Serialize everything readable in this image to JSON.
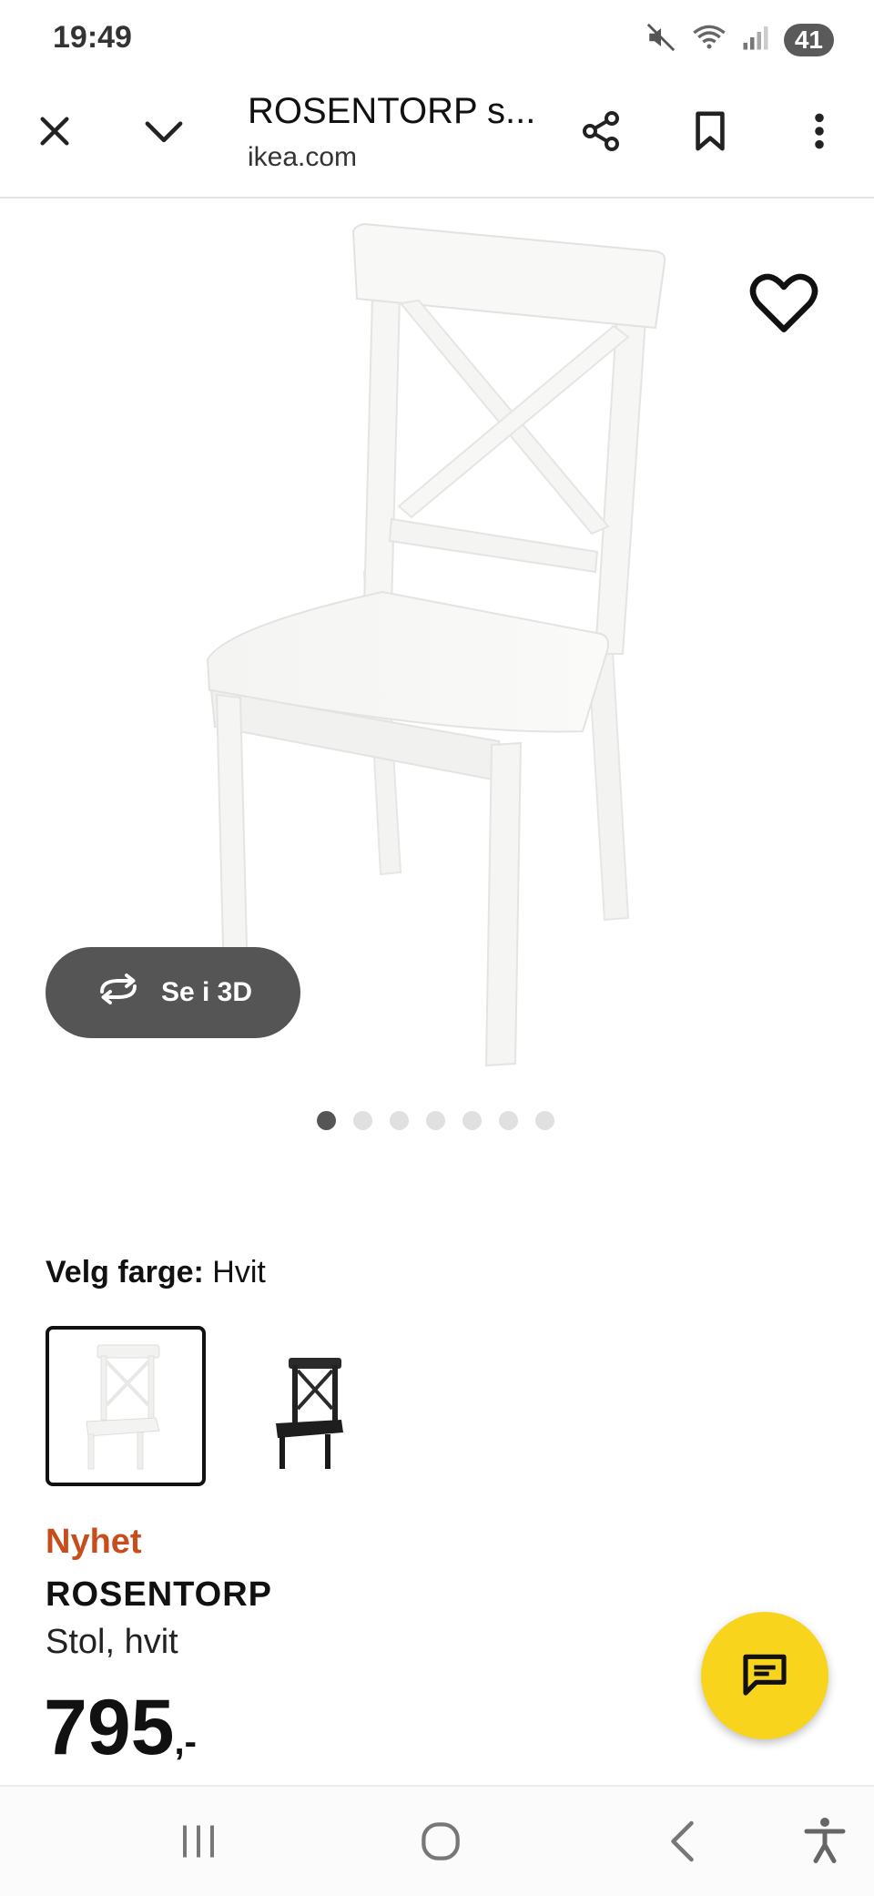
{
  "status_bar": {
    "time": "19:49",
    "battery": "41",
    "icons": [
      "mute-icon",
      "wifi-icon",
      "signal-icon",
      "battery-icon"
    ]
  },
  "browser": {
    "title": "ROSENTORP s...",
    "url": "ikea.com",
    "icons": [
      "close-icon",
      "chevron-down-icon",
      "share-icon",
      "bookmark-icon",
      "more-vert-icon"
    ]
  },
  "gallery": {
    "view_3d_label": "Se i 3D",
    "total_images": 7,
    "active_index": 0
  },
  "color_select": {
    "label": "Velg farge:",
    "value": "Hvit",
    "options": [
      "white-chair",
      "black-chair"
    ],
    "selected_index": 0
  },
  "product": {
    "badge": "Nyhet",
    "name": "ROSENTORP",
    "description": "Stol, hvit",
    "price": "795",
    "price_suffix": ",-"
  },
  "colors": {
    "badge": "#c84d1c",
    "fab": "#f8d51c",
    "pill": "#555555"
  }
}
